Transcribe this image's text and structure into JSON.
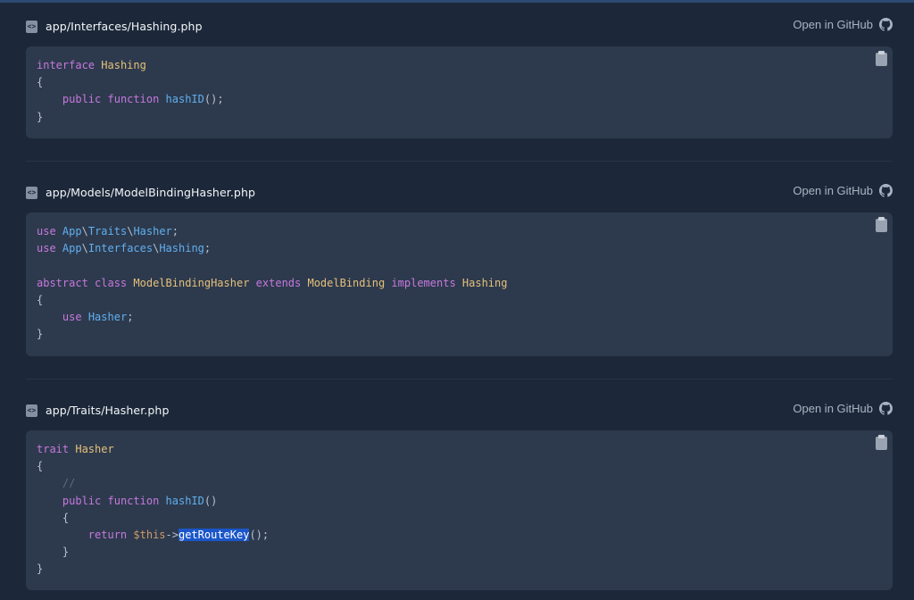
{
  "files": [
    {
      "path": "app/Interfaces/Hashing.php",
      "github_label": "Open in GitHub"
    },
    {
      "path": "app/Models/ModelBindingHasher.php",
      "github_label": "Open in GitHub"
    },
    {
      "path": "app/Traits/Hasher.php",
      "github_label": "Open in GitHub"
    }
  ],
  "code1": {
    "interface": "interface",
    "name": "Hashing",
    "open": "{",
    "public": "public",
    "function": "function",
    "method": "hashID",
    "tail": "();",
    "close": "}"
  },
  "code2": {
    "use": "use",
    "app": "App",
    "traits": "Traits",
    "hasher": "Hasher",
    "interfaces": "Interfaces",
    "hashing": "Hashing",
    "abstract": "abstract",
    "class": "class",
    "classname": "ModelBindingHasher",
    "extends": "extends",
    "parent": "ModelBinding",
    "implements": "implements",
    "open": "{",
    "close": "}"
  },
  "code3": {
    "trait": "trait",
    "name": "Hasher",
    "open": "{",
    "comment": "//",
    "public": "public",
    "function": "function",
    "method": "hashID",
    "parens": "()",
    "inner_open": "{",
    "return": "return",
    "this": "$this",
    "arrow": "->",
    "call": "getRouteKey",
    "call_tail": "();",
    "inner_close": "}",
    "close": "}"
  },
  "colors": {
    "background": "#1c2839",
    "code_background": "#2d3a4d",
    "keyword": "#c678dd",
    "class_name": "#e5c07b",
    "function_name": "#61afef",
    "selection": "#1a56c9"
  },
  "icons": {
    "file": "code-file-icon",
    "github": "github-icon",
    "copy": "clipboard-icon"
  }
}
